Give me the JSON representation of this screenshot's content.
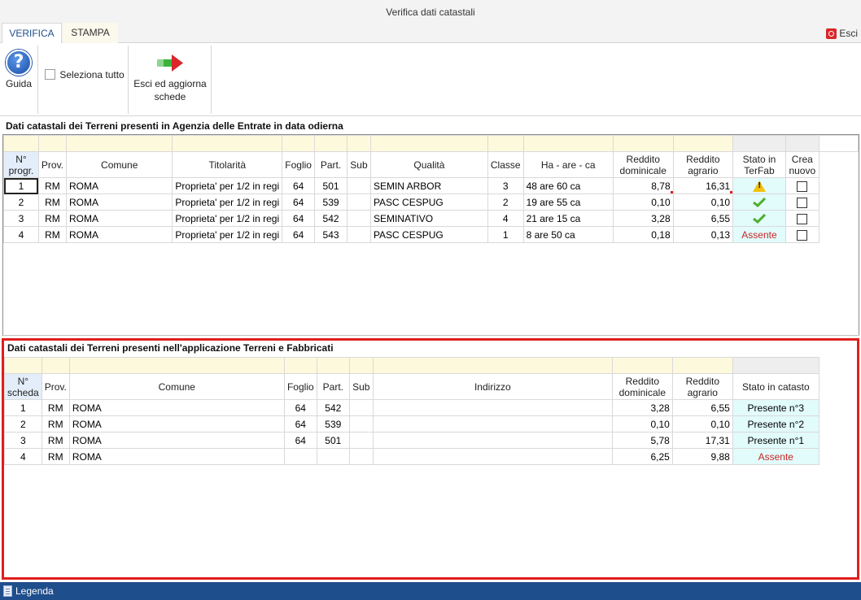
{
  "window": {
    "title": "Verifica dati catastali"
  },
  "tabs": [
    {
      "label": "VERIFICA"
    },
    {
      "label": "STAMPA"
    }
  ],
  "exit_label": "Esci",
  "ribbon": {
    "help_label": "Guida",
    "select_all_label": "Seleziona tutto",
    "exit_update_line1": "Esci ed aggiorna",
    "exit_update_line2": "schede"
  },
  "agenzia": {
    "title": "Dati catastali dei Terreni presenti in Agenzia delle Entrate in data odierna",
    "headers": {
      "num": "N° progr.",
      "prov": "Prov.",
      "comune": "Comune",
      "titolarita": "Titolarità",
      "foglio": "Foglio",
      "part": "Part.",
      "sub": "Sub",
      "qualita": "Qualità",
      "classe": "Classe",
      "ha": "Ha - are - ca",
      "dominicale": "Reddito dominicale",
      "agrario": "Reddito agrario",
      "stato": "Stato in TerFab",
      "crea": "Crea nuovo"
    },
    "rows": [
      {
        "num": "1",
        "prov": "RM",
        "comune": "ROMA",
        "titolarita": "Proprieta' per 1/2 in regi",
        "foglio": "64",
        "part": "501",
        "sub": "",
        "qualita": "SEMIN ARBOR",
        "classe": "3",
        "ha": "48 are 60 ca",
        "dominicale": "8,78",
        "agrario": "16,31",
        "stato_icon": "warning-icon",
        "stato_text": ""
      },
      {
        "num": "2",
        "prov": "RM",
        "comune": "ROMA",
        "titolarita": "Proprieta' per 1/2 in regi",
        "foglio": "64",
        "part": "539",
        "sub": "",
        "qualita": "PASC CESPUG",
        "classe": "2",
        "ha": "19 are 55 ca",
        "dominicale": "0,10",
        "agrario": "0,10",
        "stato_icon": "check-icon",
        "stato_text": ""
      },
      {
        "num": "3",
        "prov": "RM",
        "comune": "ROMA",
        "titolarita": "Proprieta' per 1/2 in regi",
        "foglio": "64",
        "part": "542",
        "sub": "",
        "qualita": "SEMINATIVO",
        "classe": "4",
        "ha": "21 are 15 ca",
        "dominicale": "3,28",
        "agrario": "6,55",
        "stato_icon": "check-icon",
        "stato_text": ""
      },
      {
        "num": "4",
        "prov": "RM",
        "comune": "ROMA",
        "titolarita": "Proprieta' per 1/2 in regi",
        "foglio": "64",
        "part": "543",
        "sub": "",
        "qualita": "PASC CESPUG",
        "classe": "1",
        "ha": "8 are 50 ca",
        "dominicale": "0,18",
        "agrario": "0,13",
        "stato_icon": "",
        "stato_text": "Assente"
      }
    ]
  },
  "terfab": {
    "title": "Dati catastali dei Terreni presenti nell'applicazione Terreni e Fabbricati",
    "headers": {
      "num": "N° scheda",
      "prov": "Prov.",
      "comune": "Comune",
      "foglio": "Foglio",
      "part": "Part.",
      "sub": "Sub",
      "indirizzo": "Indirizzo",
      "dominicale": "Reddito dominicale",
      "agrario": "Reddito agrario",
      "stato": "Stato in catasto"
    },
    "rows": [
      {
        "num": "1",
        "prov": "RM",
        "comune": "ROMA",
        "foglio": "64",
        "part": "542",
        "sub": "",
        "indirizzo": "",
        "dominicale": "3,28",
        "agrario": "6,55",
        "stato": "Presente n°3"
      },
      {
        "num": "2",
        "prov": "RM",
        "comune": "ROMA",
        "foglio": "64",
        "part": "539",
        "sub": "",
        "indirizzo": "",
        "dominicale": "0,10",
        "agrario": "0,10",
        "stato": "Presente n°2"
      },
      {
        "num": "3",
        "prov": "RM",
        "comune": "ROMA",
        "foglio": "64",
        "part": "501",
        "sub": "",
        "indirizzo": "",
        "dominicale": "5,78",
        "agrario": "17,31",
        "stato": "Presente n°1"
      },
      {
        "num": "4",
        "prov": "RM",
        "comune": "ROMA",
        "foglio": "",
        "part": "",
        "sub": "",
        "indirizzo": "",
        "dominicale": "6,25",
        "agrario": "9,88",
        "stato": "Assente"
      }
    ]
  },
  "statusbar": {
    "legend_label": "Legenda"
  },
  "colors": {
    "accent": "#1f4e8c",
    "highlight_border": "#e01e1e",
    "absent": "#c62828",
    "status_bg": "#e2fbfb",
    "filter_bg": "#fdf9dc",
    "tab_marker": "#f5b52b"
  }
}
